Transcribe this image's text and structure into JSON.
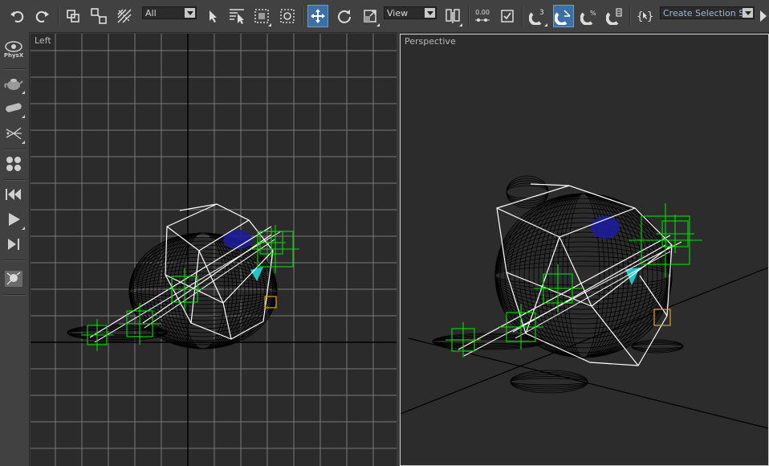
{
  "toolbar": {
    "buttons": [
      {
        "name": "undo",
        "icon": "undo-icon"
      },
      {
        "name": "redo",
        "icon": "redo-icon"
      },
      {
        "name": "select-and-link",
        "icon": "link-icon"
      },
      {
        "name": "unlink-selection",
        "icon": "unlink-icon"
      },
      {
        "name": "bind-to-space-warp",
        "icon": "space-warp-icon"
      },
      {
        "name": "select-object",
        "icon": "cursor-icon"
      },
      {
        "name": "select-by-name",
        "icon": "select-by-name-icon"
      },
      {
        "name": "rectangular-selection-region",
        "icon": "rect-selection-icon"
      },
      {
        "name": "window-crossing",
        "icon": "window-crossing-icon"
      },
      {
        "name": "select-and-move",
        "icon": "move-icon"
      },
      {
        "name": "select-and-rotate",
        "icon": "rotate-icon"
      },
      {
        "name": "select-and-scale",
        "icon": "scale-icon"
      },
      {
        "name": "use-pivot-point-center",
        "icon": "pivot-icon"
      },
      {
        "name": "keyboard-shortcut-override",
        "icon": "numeric-icon"
      },
      {
        "name": "manipulate",
        "icon": "checkbox-icon"
      },
      {
        "name": "snaps-toggle",
        "icon": "snap-3-icon"
      },
      {
        "name": "angle-snap-toggle",
        "icon": "angle-snap-icon"
      },
      {
        "name": "percent-snap-toggle",
        "icon": "percent-snap-icon"
      },
      {
        "name": "spinner-snap-toggle",
        "icon": "spinner-snap-icon"
      },
      {
        "name": "edit-named-selection-sets",
        "icon": "named-sets-icon"
      }
    ],
    "selection_filter": "All",
    "reference_coordinate_system": "View",
    "numeric_label": "0.00",
    "snap_label": "3",
    "named_selection_set": "Create Selection Set"
  },
  "sidebar": {
    "physx_label": "PhysX",
    "tools": [
      "physx-icon",
      "teapot-icon",
      "capsule-icon",
      "particles-icon",
      "dots-icon",
      "rewind-icon",
      "play-icon",
      "step-forward-icon",
      "scene-icon"
    ]
  },
  "viewports": {
    "left_label": "Left",
    "perspective_label": "Perspective"
  },
  "colors": {
    "background": "#3a3a3a",
    "toolbar": "#414141",
    "viewport": "#2b2b2b",
    "grid": "#7a7a7a",
    "wire_dark": "#000000",
    "cage": "#ffffff",
    "helper": "#00e000",
    "eye": "#1d1d9a",
    "accent": "#3b6fa5"
  }
}
